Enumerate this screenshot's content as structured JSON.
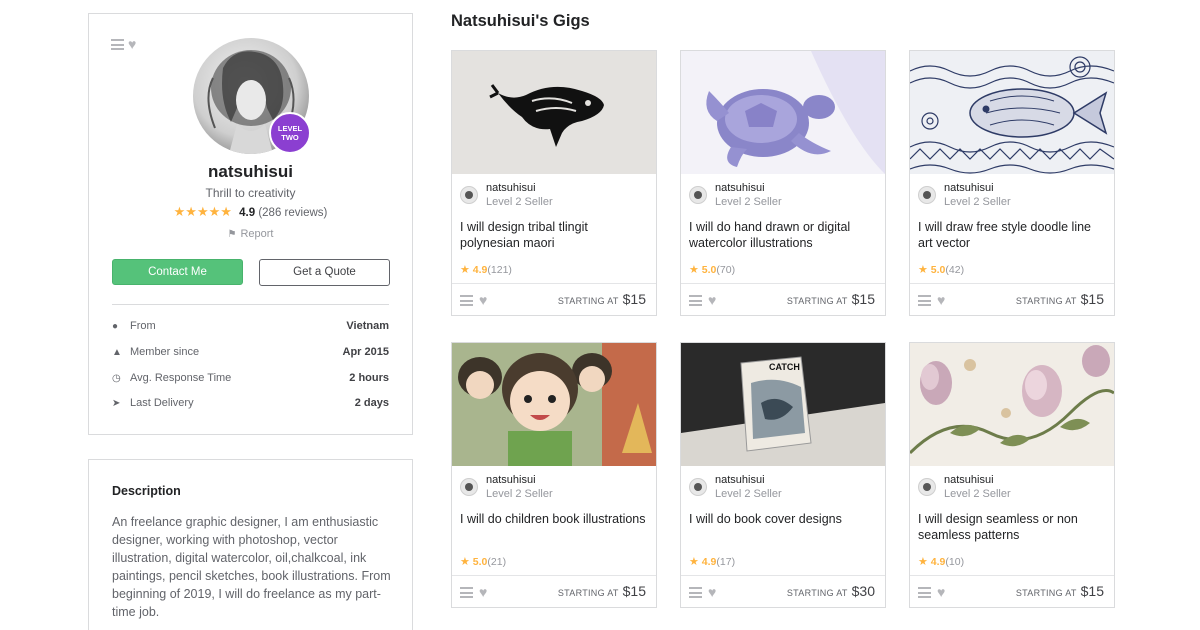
{
  "profile": {
    "username": "natsuhisui",
    "level_badge": [
      "LEVEL",
      "TWO"
    ],
    "tagline": "Thrill to creativity",
    "stars": "★★★★★",
    "rating": "4.9",
    "reviews": "(286 reviews)",
    "report": "Report",
    "contact_label": "Contact Me",
    "quote_label": "Get a Quote",
    "stats": [
      {
        "icon": "location-pin-icon",
        "label": "From",
        "value": "Vietnam"
      },
      {
        "icon": "person-icon",
        "label": "Member since",
        "value": "Apr 2015"
      },
      {
        "icon": "clock-icon",
        "label": "Avg. Response Time",
        "value": "2 hours"
      },
      {
        "icon": "paper-plane-icon",
        "label": "Last Delivery",
        "value": "2 days"
      }
    ]
  },
  "description": {
    "title": "Description",
    "text": "An freelance graphic designer, I am enthusiastic designer, working with photoshop, vector illustration, digital watercolor, oil,chalkcoal, ink paintings, pencil sketches, book illustrations. From beginning of 2019, I will do freelance as my part-time job."
  },
  "gigs_heading": "Natsuhisui's Gigs",
  "starting_at_label": "STARTING AT",
  "gigs": [
    {
      "seller": "natsuhisui",
      "level": "Level 2 Seller",
      "title": "I will design tribal tlingit polynesian maori",
      "rating": "4.9",
      "count": "(121)",
      "price": "$15",
      "image": "tribal-whale"
    },
    {
      "seller": "natsuhisui",
      "level": "Level 2 Seller",
      "title": "I will do hand drawn or digital watercolor illustrations",
      "rating": "5.0",
      "count": "(70)",
      "price": "$15",
      "image": "watercolor-turtle"
    },
    {
      "seller": "natsuhisui",
      "level": "Level 2 Seller",
      "title": "I will draw free style doodle line art vector",
      "rating": "5.0",
      "count": "(42)",
      "price": "$15",
      "image": "doodle-fish"
    },
    {
      "seller": "natsuhisui",
      "level": "Level 2 Seller",
      "title": "I will do children book illustrations",
      "rating": "5.0",
      "count": "(21)",
      "price": "$15",
      "image": "children-book"
    },
    {
      "seller": "natsuhisui",
      "level": "Level 2 Seller",
      "title": "I will do book cover designs",
      "rating": "4.9",
      "count": "(17)",
      "price": "$30",
      "image": "book-cover",
      "image_text": "CATCH"
    },
    {
      "seller": "natsuhisui",
      "level": "Level 2 Seller",
      "title": "I will design seamless or non seamless patterns",
      "rating": "4.9",
      "count": "(10)",
      "price": "$15",
      "image": "floral-pattern"
    }
  ],
  "colors": {
    "accent_green": "#55c27a",
    "level_badge_purple": "#8b3fd1",
    "star_yellow": "#ffb33e"
  }
}
